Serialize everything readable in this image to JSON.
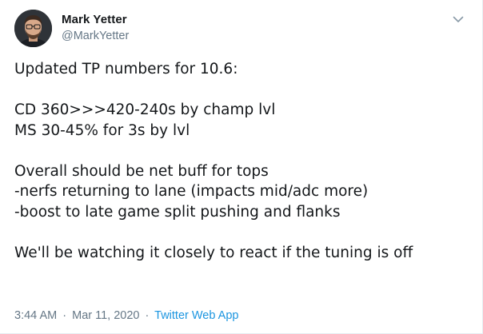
{
  "author": {
    "name": "Mark Yetter",
    "handle": "@MarkYetter"
  },
  "menu_icon": "chevron-down-icon",
  "tweet": {
    "lines": [
      "Updated TP numbers for 10.6:",
      "",
      "CD 360>>>420-240s by champ lvl",
      "MS 30-45% for 3s by lvl",
      "",
      "Overall should be net buff for tops",
      "-nerfs returning to lane (impacts mid/adc more)",
      "-boost to late game split pushing and flanks",
      "",
      "We'll be watching it closely to react if the tuning is off"
    ]
  },
  "meta": {
    "time": "3:44 AM",
    "separator": "·",
    "date": "Mar 11, 2020",
    "source": "Twitter Web App"
  },
  "colors": {
    "text": "#14171a",
    "secondary": "#657786",
    "link": "#1b95e0"
  }
}
